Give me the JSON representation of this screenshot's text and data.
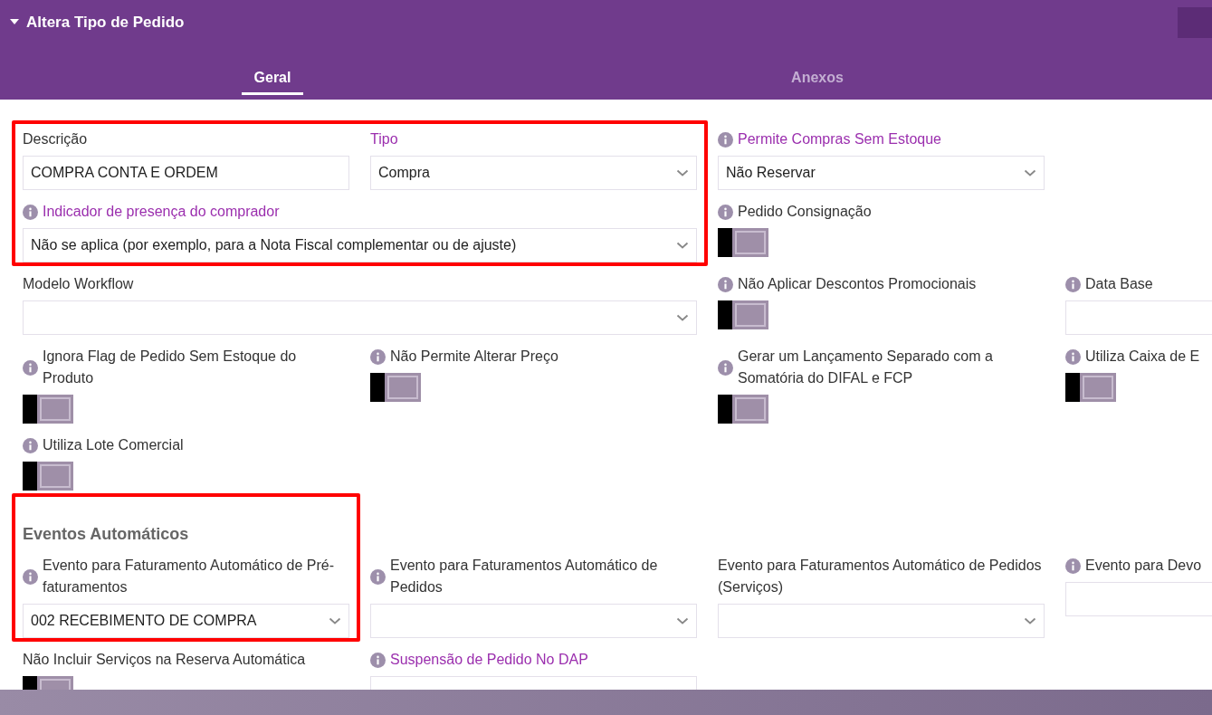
{
  "panel": {
    "title": "Altera Tipo de Pedido",
    "expanded": true
  },
  "tabs": [
    {
      "label": "Geral",
      "selected": true
    },
    {
      "label": "Anexos",
      "selected": false
    }
  ],
  "sections": [
    {
      "groups": [
        {
          "framed": true,
          "fields": [
            {
              "label": "Descrição",
              "kind": "text",
              "value": "COMPRA CONTA E ORDEM",
              "required": false
            },
            {
              "label": "Tipo",
              "kind": "select",
              "value": "Compra",
              "required": true
            },
            {
              "label": "Indicador de presença do comprador",
              "kind": "select",
              "value": "Não se aplica (por exemplo, para a Nota Fiscal complementar ou de ajuste)",
              "required": true,
              "info": true
            }
          ]
        },
        {
          "fields": [
            {
              "label": "Permite Compras Sem Estoque",
              "kind": "select",
              "value": "Não Reservar",
              "required": true,
              "info": true
            },
            {
              "label": "Pedido Consignação",
              "kind": "toggle",
              "on": true,
              "required": false,
              "info": true
            },
            {
              "label": "Modelo Workflow",
              "kind": "select",
              "required": false
            },
            {
              "label": "Não Aplicar Descontos Promocionais",
              "kind": "toggle",
              "on": true,
              "required": false,
              "info": true
            },
            {
              "label": "Data Base",
              "kind": "text",
              "required": false,
              "info": true
            },
            {
              "label": "Ignora Flag de Pedido Sem Estoque do Produto",
              "kind": "toggle",
              "on": true,
              "required": false,
              "info": true
            },
            {
              "label": "Não Permite Alterar Preço",
              "kind": "toggle",
              "on": true,
              "required": false,
              "info": true
            },
            {
              "label": "Gerar um Lançamento Separado com a Somatória do DIFAL e FCP",
              "kind": "toggle",
              "on": true,
              "required": false,
              "info": true
            },
            {
              "label": "Utiliza Caixa de E",
              "kind": "toggle",
              "on": true,
              "required": false,
              "info": true
            },
            {
              "label": "Utiliza Lote Comercial",
              "kind": "toggle",
              "on": true,
              "required": false,
              "info": true
            }
          ]
        }
      ]
    },
    {
      "groups": [
        {
          "framed": true,
          "title": "Eventos Automáticos",
          "fields": [
            {
              "label": "Evento para Faturamento Automático de Pré-faturamentos",
              "kind": "select",
              "value": "002 RECEBIMENTO DE COMPRA",
              "required": false,
              "info": true
            }
          ]
        },
        {
          "fields": [
            {
              "label": "Evento para Faturamentos Automático de Pedidos",
              "kind": "select",
              "required": false,
              "info": true
            },
            {
              "label": "Evento para Faturamentos Automático de Pedidos (Serviços)",
              "kind": "select",
              "required": false
            },
            {
              "label": "Evento para Devo",
              "kind": "text",
              "required": false,
              "info": true
            },
            {
              "label": "Não Incluir Serviços na Reserva Automática",
              "kind": "toggle",
              "on": true,
              "required": false
            },
            {
              "label": "Suspensão de Pedido No DAP",
              "kind": "select",
              "required": true,
              "info": true
            }
          ]
        }
      ]
    }
  ]
}
